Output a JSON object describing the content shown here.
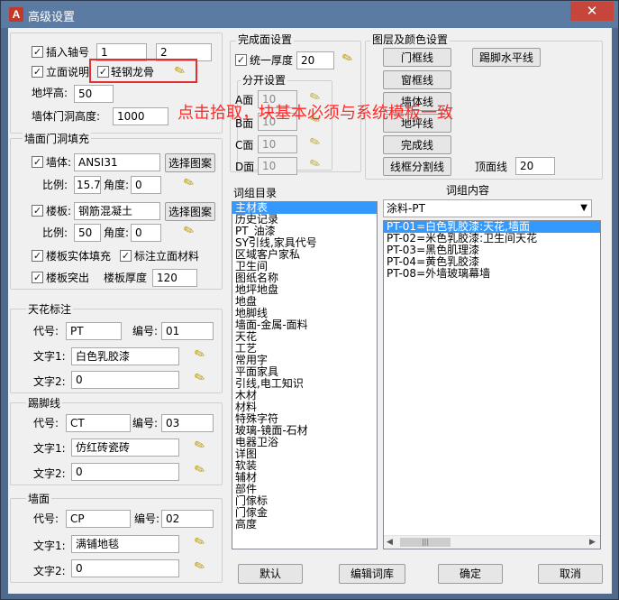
{
  "window": {
    "title": "高级设置",
    "close_glyph": "✕",
    "icon_letter": "A"
  },
  "top": {
    "insert_axis": "插入轴号",
    "axis_val1": "1",
    "axis_val2": "2",
    "elevation_note": "立面说明",
    "light_keel": "轻钢龙骨",
    "floor_height_label": "地坪高:",
    "floor_height": "50",
    "wall_door_height_label": "墙体门洞高度:",
    "wall_door_height": "1000"
  },
  "annotation": "点击拾取，块基本必须与系统模板一致",
  "finish": {
    "title": "完成面设置",
    "uniform_thickness": "统一厚度",
    "uniform_value": "20",
    "split_title": "分开设置",
    "rows": [
      {
        "label": "A面",
        "value": "10"
      },
      {
        "label": "B面",
        "value": "10"
      },
      {
        "label": "C面",
        "value": "10"
      },
      {
        "label": "D面",
        "value": "10"
      }
    ]
  },
  "layers": {
    "title": "图层及颜色设置",
    "buttons": [
      "门框线",
      "窗框线",
      "墙体线",
      "地坪线",
      "完成线",
      "线框分割线"
    ],
    "skirting_btn": "踢脚水平线",
    "ceiling_line_label": "顶面线",
    "ceiling_line_value": "20"
  },
  "wall_fill": {
    "title": "墙面门洞填充",
    "wall_label": "墙体:",
    "wall_pattern": "ANSI31",
    "choose": "选择图案",
    "scale_label": "比例:",
    "wall_scale": "15.74",
    "angle_label": "角度:",
    "wall_angle": "0",
    "slab_label": "楼板:",
    "slab_pattern": "钢筋混凝土",
    "slab_scale": "50",
    "slab_angle": "0",
    "slab_solid": "楼板实体填充",
    "mark_material": "标注立面材料",
    "slab_protrude": "楼板突出",
    "slab_thickness_label": "楼板厚度",
    "slab_thickness": "120"
  },
  "ceiling": {
    "title": "天花标注",
    "code_label": "代号:",
    "code": "PT",
    "num_label": "编号:",
    "num": "01",
    "text1_label": "文字1:",
    "text1": "白色乳胶漆",
    "text2_label": "文字2:",
    "text2": "0"
  },
  "skirting": {
    "title": "踢脚线",
    "code_label": "代号:",
    "code": "CT",
    "num_label": "编号:",
    "num": "03",
    "text1_label": "文字1:",
    "text1": "仿红砖瓷砖",
    "text2_label": "文字2:",
    "text2": "0"
  },
  "wall": {
    "title": "墙面",
    "code_label": "代号:",
    "code": "CP",
    "num_label": "编号:",
    "num": "02",
    "text1_label": "文字1:",
    "text1": "满铺地毯",
    "text2_label": "文字2:",
    "text2": "0"
  },
  "catalog": {
    "title": "词组目录",
    "items": [
      "主材表",
      "历史记录",
      "PT_油漆",
      "SY引线,家具代号",
      "区域客户家私",
      "卫生间",
      "图纸名称",
      "地坪地盘",
      "地盘",
      "地脚线",
      "墙面-金属-面料",
      "天花",
      "工艺",
      "常用字",
      "平面家具",
      "引线,电工知识",
      "木材",
      "材料",
      "特殊字符",
      "玻璃-镜面-石材",
      "电器卫浴",
      "详图",
      "软装",
      "辅材",
      "部件",
      "门傢标",
      "门傢金",
      "高度"
    ]
  },
  "content": {
    "title": "词组内容",
    "dropdown": "涂料-PT",
    "items": [
      "PT-01=白色乳胶漆:天花,墙面",
      "PT-02=米色乳胶漆:卫生间天花",
      "PT-03=黑色肌理漆",
      "PT-04=黄色乳胶漆",
      "PT-08=外墙玻璃幕墙"
    ]
  },
  "footer": {
    "default": "默认",
    "edit_lib": "编辑词库",
    "ok": "确定",
    "cancel": "取消"
  }
}
